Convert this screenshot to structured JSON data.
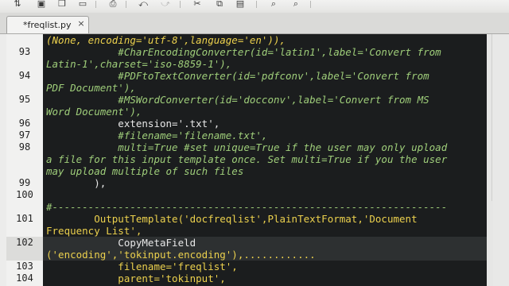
{
  "toolbar": {
    "icons": [
      "sort-icon",
      "new-icon",
      "copy-doc-icon",
      "open-icon",
      "print-icon",
      "cut-icon",
      "copy-icon",
      "paste-icon",
      "find-icon",
      "replace-icon",
      "arrow-icon"
    ]
  },
  "tab": {
    "label": "*freqlist.py",
    "close": "×"
  },
  "editor": {
    "lines": [
      {
        "num": "",
        "text": "(None, encoding='utf-8',language='en')),"
      },
      {
        "num": "93",
        "text": "            #CharEncodingConverter(id='latin1',label='Convert from"
      },
      {
        "num": "",
        "text": "Latin-1',charset='iso-8859-1'),"
      },
      {
        "num": "94",
        "text": "            #PDFtoTextConverter(id='pdfconv',label='Convert from"
      },
      {
        "num": "",
        "text": "PDF Document'),"
      },
      {
        "num": "95",
        "text": "            #MSWordConverter(id='docconv',label='Convert from MS"
      },
      {
        "num": "",
        "text": "Word Document'),"
      },
      {
        "num": "96",
        "text": "            extension='.txt',"
      },
      {
        "num": "97",
        "text": "            #filename='filename.txt',"
      },
      {
        "num": "98",
        "text": "            multi=True #set unique=True if the user may only upload"
      },
      {
        "num": "",
        "text": "a file for this input template once. Set multi=True if you the user"
      },
      {
        "num": "",
        "text": "may upload multiple of such files"
      },
      {
        "num": "99",
        "text": "        ),"
      },
      {
        "num": "100",
        "text": ""
      },
      {
        "num": "",
        "text": "#------------------------------------------------------------------"
      },
      {
        "num": "101",
        "text": "        OutputTemplate('docfreqlist',PlainTextFormat,'Document"
      },
      {
        "num": "",
        "text": "Frequency List',"
      },
      {
        "num": "102",
        "text": "            CopyMetaField"
      },
      {
        "num": "",
        "text": "('encoding','tokinput.encoding'),............"
      },
      {
        "num": "103",
        "text": "            filename='freqlist',"
      },
      {
        "num": "104",
        "text": "            parent='tokinput',"
      }
    ]
  },
  "colors": {
    "editor_bg": "#1b1d1e",
    "comment": "#9fce7a",
    "string": "#ecd14d",
    "keyword": "#ff6a3d"
  }
}
